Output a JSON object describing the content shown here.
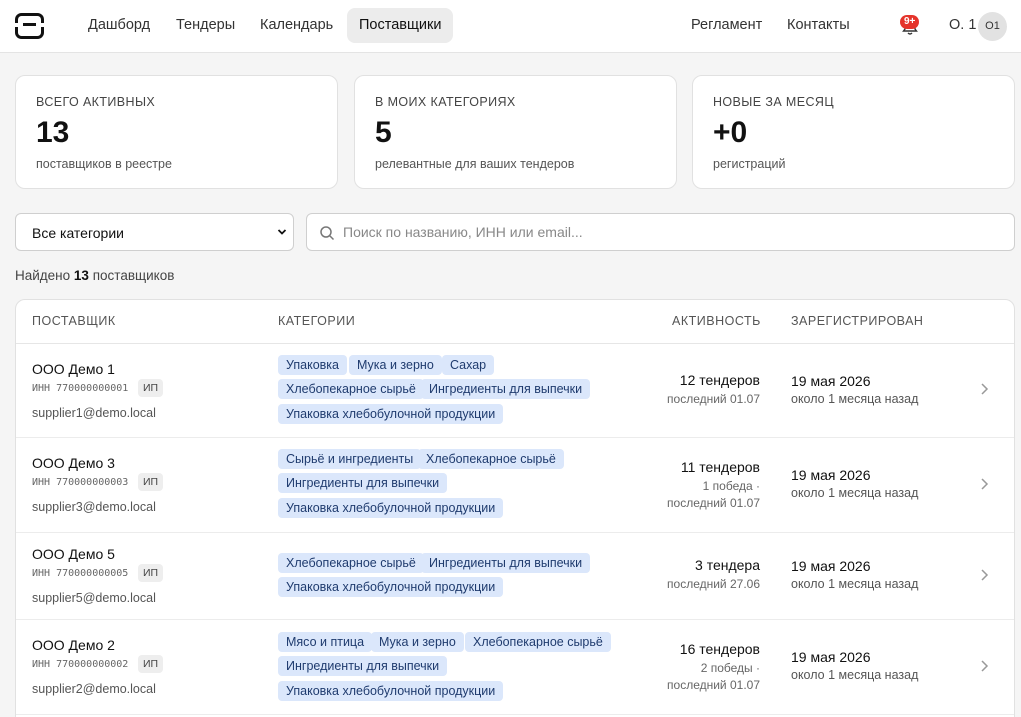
{
  "nav": {
    "links": [
      {
        "label": "Дашборд",
        "active": false
      },
      {
        "label": "Тендеры",
        "active": false
      },
      {
        "label": "Календарь",
        "active": false
      },
      {
        "label": "Поставщики",
        "active": true
      }
    ],
    "right_links": [
      {
        "label": "Регламент"
      },
      {
        "label": "Контакты"
      }
    ],
    "notifications_badge": "9+",
    "user_name": "О. 1",
    "avatar_initials": "О1"
  },
  "stats": [
    {
      "label": "Всего активных",
      "value": "13",
      "sub": "поставщиков в реестре"
    },
    {
      "label": "В моих категориях",
      "value": "5",
      "sub": "релевантные для ваших тендеров"
    },
    {
      "label": "Новые за месяц",
      "value": "+0",
      "sub": "регистраций"
    }
  ],
  "filters": {
    "category_selected": "Все категории",
    "search_placeholder": "Поиск по названию, ИНН или email...",
    "search_value": ""
  },
  "found": {
    "prefix": "Найдено",
    "count": "13",
    "suffix": "поставщиков"
  },
  "table": {
    "headers": {
      "supplier": "Поставщик",
      "categories": "Категории",
      "activity": "Активность",
      "registered": "Зарегистрирован"
    },
    "rows": [
      {
        "name": "ООО Демо 1",
        "inn": "ИНН 770000000001",
        "type": "ИП",
        "email": "supplier1@demo.local",
        "tags": [
          "Упаковка",
          "Мука и зерно",
          "Сахар",
          "Хлебопекарное сырьё",
          "Ингредиенты для выпечки",
          "Упаковка хлебобулочной продукции"
        ],
        "activity_main": "12 тендеров",
        "activity_sub": [
          "последний 01.07"
        ],
        "reg_date": "19 мая 2026",
        "reg_ago": "около 1 месяца назад"
      },
      {
        "name": "ООО Демо 3",
        "inn": "ИНН 770000000003",
        "type": "ИП",
        "email": "supplier3@demo.local",
        "tags": [
          "Сырьё и ингредиенты",
          "Хлебопекарное сырьё",
          "Ингредиенты для выпечки",
          "Упаковка хлебобулочной продукции"
        ],
        "activity_main": "11 тендеров",
        "activity_sub": [
          "1 победа ·",
          "последний 01.07"
        ],
        "reg_date": "19 мая 2026",
        "reg_ago": "около 1 месяца назад"
      },
      {
        "name": "ООО Демо 5",
        "inn": "ИНН 770000000005",
        "type": "ИП",
        "email": "supplier5@demo.local",
        "tags": [
          "Хлебопекарное сырьё",
          "Ингредиенты для выпечки",
          "Упаковка хлебобулочной продукции"
        ],
        "activity_main": "3 тендера",
        "activity_sub": [
          "последний 27.06"
        ],
        "reg_date": "19 мая 2026",
        "reg_ago": "около 1 месяца назад"
      },
      {
        "name": "ООО Демо 2",
        "inn": "ИНН 770000000002",
        "type": "ИП",
        "email": "supplier2@demo.local",
        "tags": [
          "Мясо и птица",
          "Мука и зерно",
          "Хлебопекарное сырьё",
          "Ингредиенты для выпечки",
          "Упаковка хлебобулочной продукции"
        ],
        "activity_main": "16 тендеров",
        "activity_sub": [
          "2 победы ·",
          "последний 01.07"
        ],
        "reg_date": "19 мая 2026",
        "reg_ago": "около 1 месяца назад"
      }
    ]
  }
}
